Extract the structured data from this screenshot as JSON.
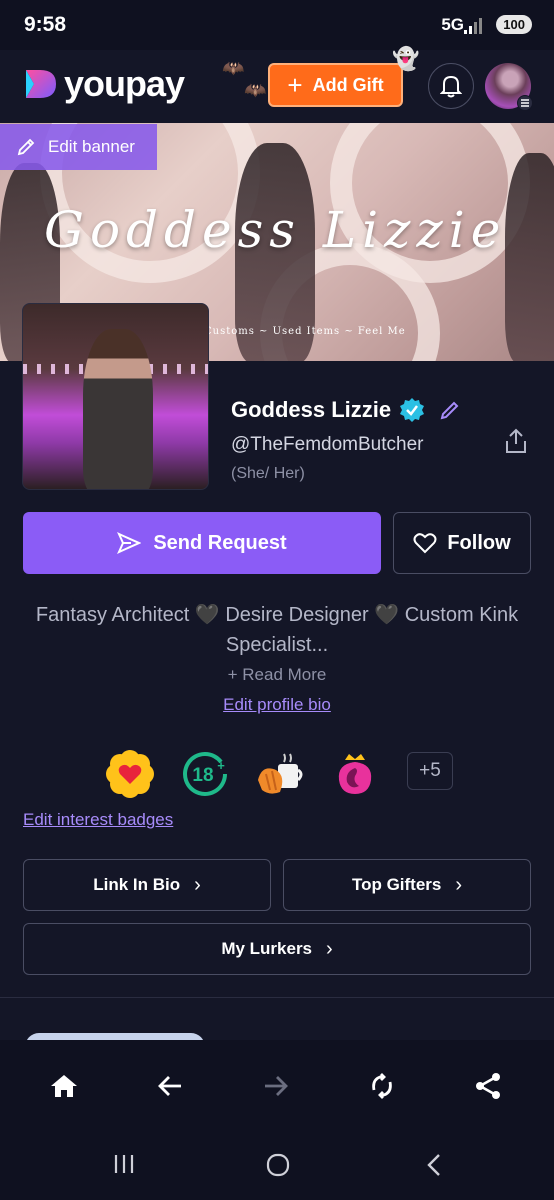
{
  "status_bar": {
    "time": "9:58",
    "network": "5G",
    "battery": "100"
  },
  "header": {
    "logo_text": "youpay",
    "add_gift_label": "Add Gift",
    "add_gift_plus": "+"
  },
  "banner": {
    "edit_label": "Edit banner",
    "title": "Goddess Lizzie",
    "subtitle": "Customs ~ Used Items ~ Feel Me"
  },
  "profile": {
    "display_name": "Goddess Lizzie",
    "handle": "@TheFemdomButcher",
    "pronouns": "(She/ Her)"
  },
  "actions": {
    "send_request": "Send Request",
    "follow": "Follow"
  },
  "bio": {
    "text": "Fantasy Architect 🖤 Desire Designer 🖤 Custom Kink Specialist...",
    "read_more": "+ Read More",
    "edit_link": "Edit profile bio"
  },
  "badges": {
    "items": [
      "heart-flower-badge",
      "eighteen-plus-badge",
      "croissant-coffee-badge",
      "crown-badge"
    ],
    "more": "+5",
    "edit_link": "Edit interest badges"
  },
  "links": {
    "link_in_bio": "Link In Bio",
    "top_gifters": "Top Gifters",
    "my_lurkers": "My Lurkers",
    "chevron": "›"
  },
  "colors": {
    "background": "#141627",
    "accent_purple": "#8b5cf6",
    "link_purple": "#a78bfa",
    "orange": "#ff6b1a",
    "verified": "#2bc0e4"
  }
}
